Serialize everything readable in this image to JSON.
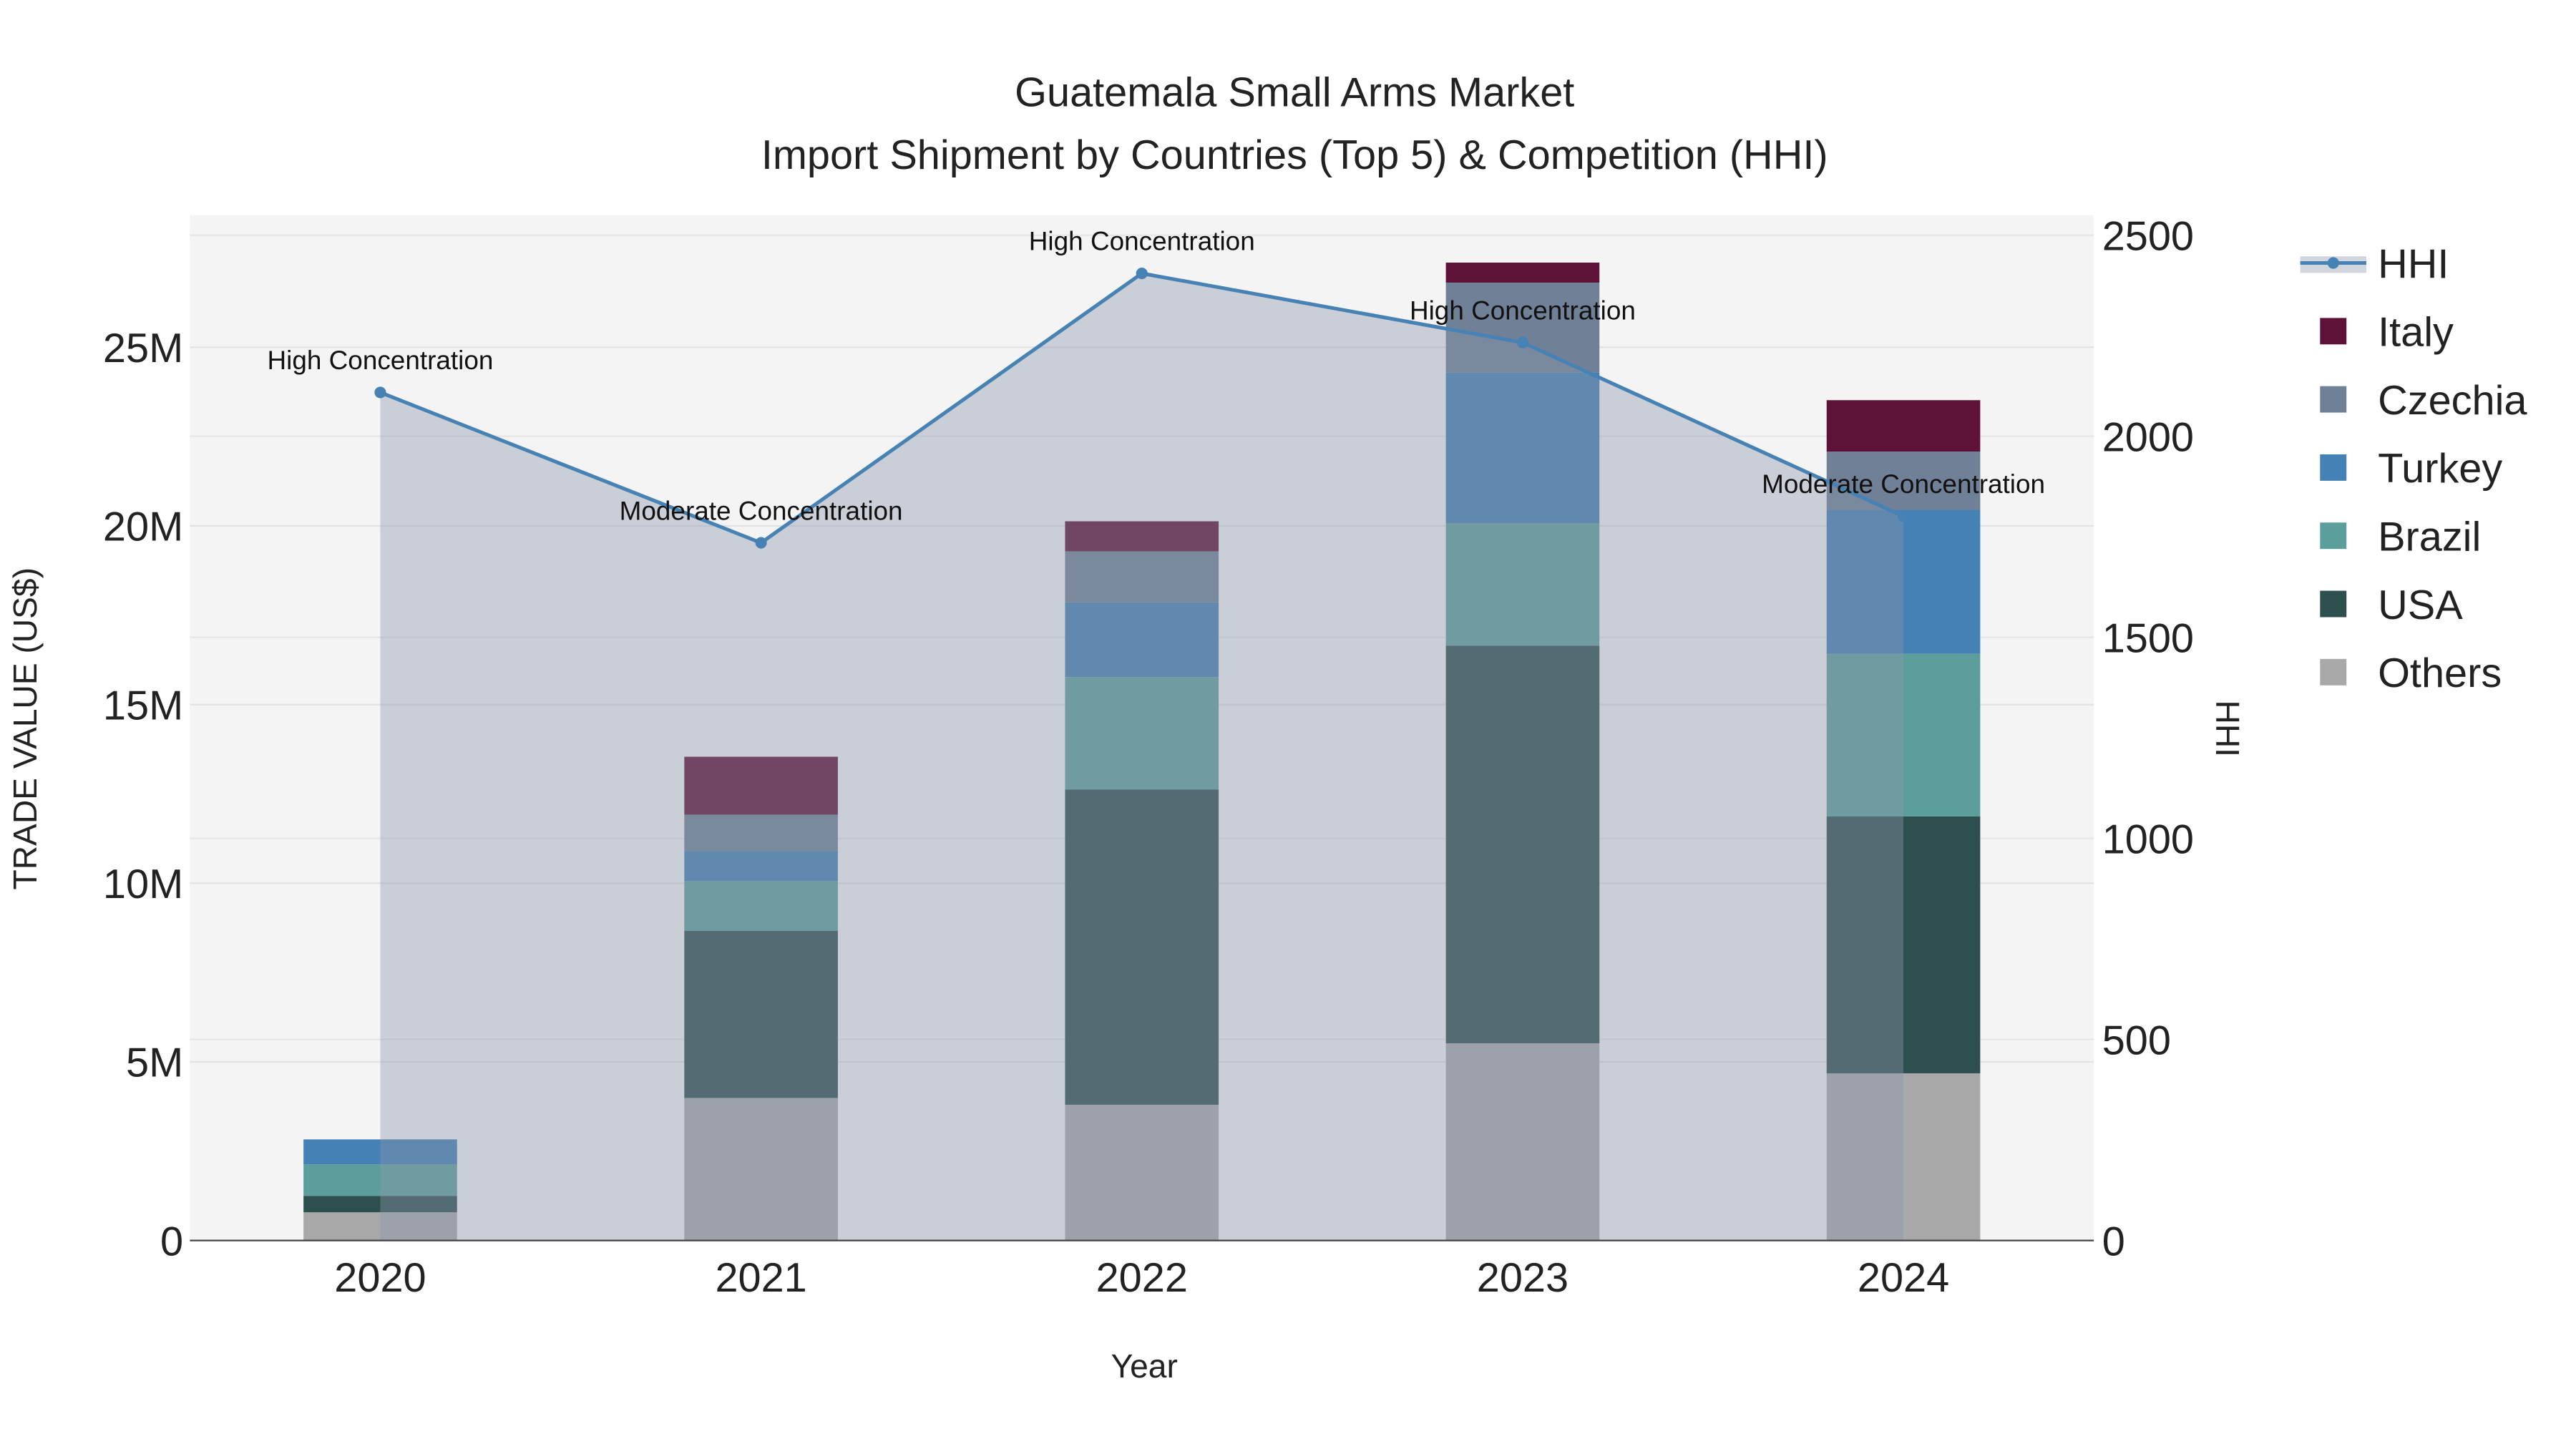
{
  "chart_data": {
    "type": "bar",
    "title": "Guatemala Small Arms Market",
    "subtitle": "Import Shipment by Countries (Top 5) & Competition (HHI)",
    "xlabel": "Year",
    "ylabel": "TRADE VALUE (US$)",
    "y2label": "HHI",
    "categories": [
      "2020",
      "2021",
      "2022",
      "2023",
      "2024"
    ],
    "ylim": [
      0,
      28700000
    ],
    "y2lim": [
      0,
      2550
    ],
    "yticks": [
      0,
      5000000,
      10000000,
      15000000,
      20000000,
      25000000
    ],
    "ytick_labels": [
      "0",
      "5M",
      "10M",
      "15M",
      "20M",
      "25M"
    ],
    "y2ticks": [
      0,
      500,
      1000,
      1500,
      2000,
      2500
    ],
    "y2tick_labels": [
      "0",
      "500",
      "1000",
      "1500",
      "2000",
      "2500"
    ],
    "stacked": true,
    "series": [
      {
        "name": "Others",
        "color": "#a8a8a8",
        "values": [
          790000,
          3990000,
          3800000,
          5520000,
          4680000
        ]
      },
      {
        "name": "USA",
        "color": "#2d4f4d",
        "values": [
          460000,
          4680000,
          8820000,
          11130000,
          7190000
        ]
      },
      {
        "name": "Brazil",
        "color": "#5c9e9c",
        "values": [
          880000,
          1390000,
          3150000,
          3430000,
          4550000
        ]
      },
      {
        "name": "Turkey",
        "color": "#4581b4",
        "values": [
          700000,
          840000,
          2090000,
          4220000,
          4030000
        ]
      },
      {
        "name": "Czechia",
        "color": "#708096",
        "values": [
          0,
          1020000,
          1430000,
          2510000,
          1630000
        ]
      },
      {
        "name": "Italy",
        "color": "#5f1237",
        "values": [
          0,
          1620000,
          840000,
          560000,
          1440000
        ]
      }
    ],
    "line": {
      "name": "HHI",
      "color": "#4682b4",
      "values": [
        2109,
        1735,
        2405,
        2233,
        1801
      ],
      "annotations": [
        "High Concentration",
        "Moderate Concentration",
        "High Concentration",
        "High Concentration",
        "Moderate Concentration"
      ]
    },
    "legend_order": [
      "HHI",
      "Italy",
      "Czechia",
      "Turkey",
      "Brazil",
      "USA",
      "Others"
    ],
    "legend_position": "right",
    "grid": true
  }
}
